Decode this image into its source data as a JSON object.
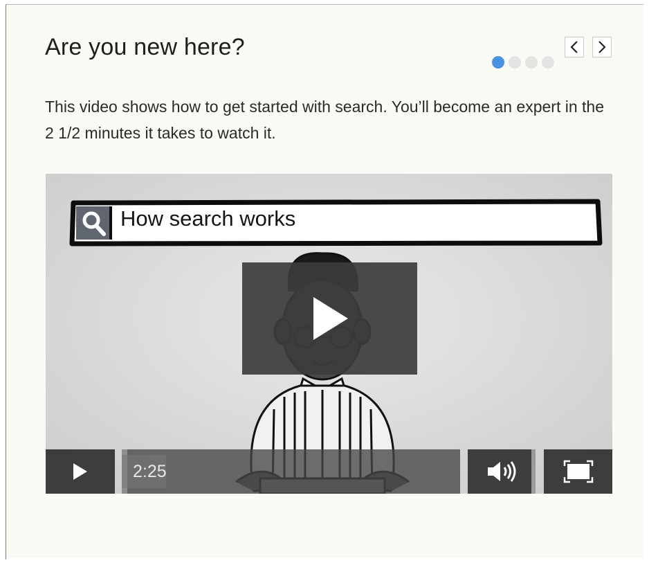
{
  "panel": {
    "title": "Are you new here?",
    "description": "This video shows how to get started with search. You’ll become an expert in the 2 1/2 minutes it takes to watch it.",
    "pager": {
      "total": 4,
      "active_index": 0,
      "prev_icon": "chevron-left-icon",
      "next_icon": "chevron-right-icon"
    }
  },
  "video": {
    "search_text": "How search works",
    "current_time": "2:25",
    "progress_fraction": 0.13,
    "icons": [
      "search-icon",
      "play-icon",
      "volume-icon",
      "fullscreen-icon"
    ]
  },
  "colors": {
    "accent": "#4a90e2",
    "panel_bg": "#fbfbf5",
    "control_bg": "#3d3d3d"
  }
}
